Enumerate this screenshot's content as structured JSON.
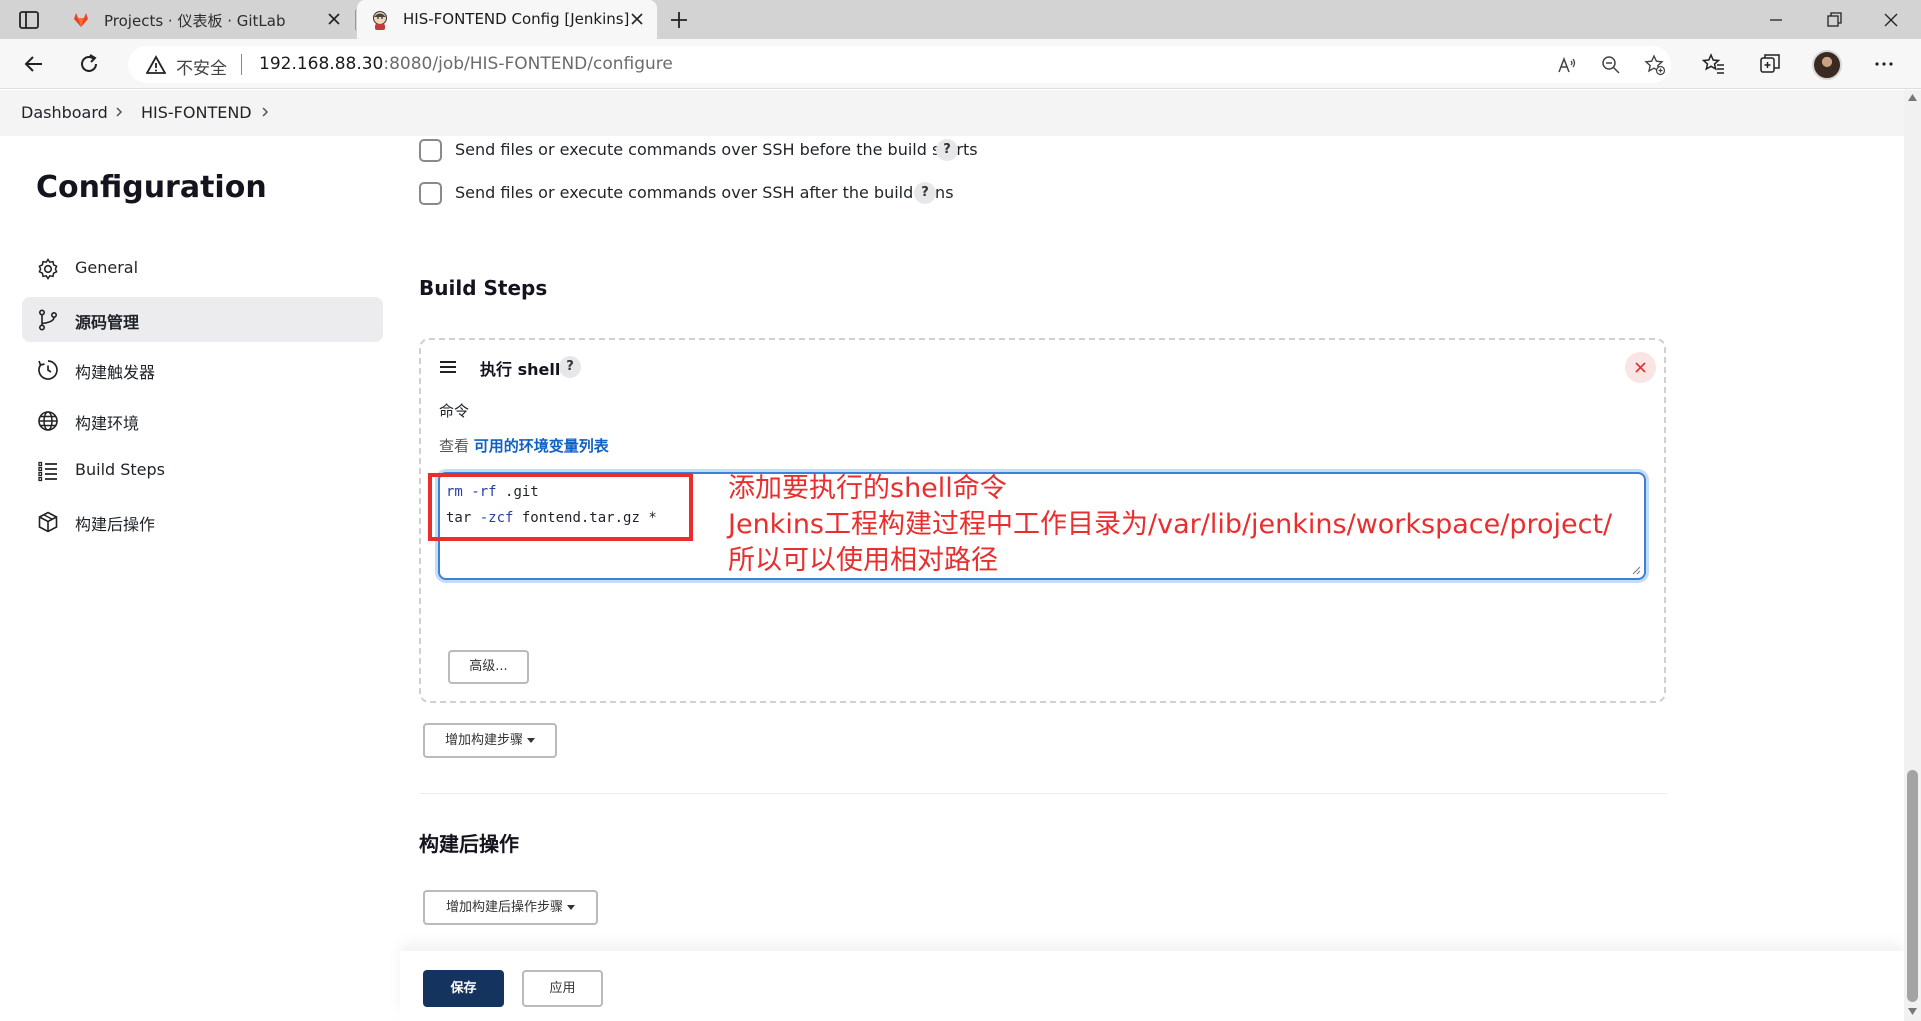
{
  "browser": {
    "tabs": [
      {
        "title": "Projects · 仪表板 · GitLab",
        "active": false
      },
      {
        "title": "HIS-FONTEND Config [Jenkins]",
        "active": true
      }
    ],
    "address": {
      "security_label": "不安全",
      "host": "192.168.88.30",
      "path": ":8080/job/HIS-FONTEND/configure"
    }
  },
  "breadcrumb": {
    "items": [
      "Dashboard",
      "HIS-FONTEND"
    ]
  },
  "sidebar": {
    "title": "Configuration",
    "items": [
      {
        "label": "General",
        "icon": "gear-icon",
        "active": false
      },
      {
        "label": "源码管理",
        "icon": "branch-icon",
        "active": true
      },
      {
        "label": "构建触发器",
        "icon": "clock-icon",
        "active": false
      },
      {
        "label": "构建环境",
        "icon": "globe-icon",
        "active": false
      },
      {
        "label": "Build Steps",
        "icon": "list-icon",
        "active": false
      },
      {
        "label": "构建后操作",
        "icon": "cube-icon",
        "active": false
      }
    ]
  },
  "main": {
    "ssh_options": [
      {
        "label": "Send files or execute commands over SSH before the build starts",
        "checked": false
      },
      {
        "label": "Send files or execute commands over SSH after the build runs",
        "checked": false
      }
    ],
    "build_steps_title": "Build Steps",
    "step": {
      "title": "执行 shell",
      "command_label": "命令",
      "env_prefix": "查看 ",
      "env_link": "可用的环境变量列表",
      "code": {
        "line1_cmd": "rm",
        "line1_flag": "-rf",
        "line1_rest": " .git",
        "line2_cmd": "tar",
        "line2_flag": "-zcf",
        "line2_rest": " fontend.tar.gz *"
      },
      "advanced_label": "高级..."
    },
    "add_step_label": "增加构建步骤",
    "post_title": "构建后操作",
    "add_post_label": "增加构建后操作步骤",
    "save_label": "保存",
    "apply_label": "应用",
    "help_mark": "?"
  },
  "annotation": {
    "color": "#ea2e2e",
    "lines": [
      "添加要执行的shell命令",
      "Jenkins工程构建过程中工作目录为/var/lib/jenkins/workspace/project/",
      "所以可以使用相对路径"
    ]
  },
  "colors": {
    "save_button": "#14335e",
    "link": "#1061c4",
    "textarea_focus": "#3e7fd8"
  }
}
